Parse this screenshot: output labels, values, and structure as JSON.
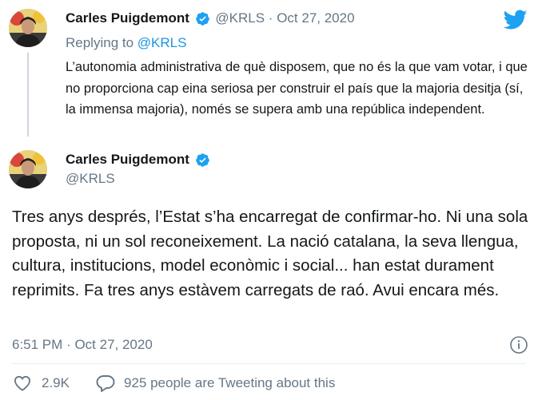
{
  "reply_tweet": {
    "author_name": "Carles Puigdemont",
    "handle": "@KRLS",
    "separator": "·",
    "date": "Oct 27, 2020",
    "replying_label": "Replying to",
    "replying_handle": "@KRLS",
    "text": "L’autonomia administrativa de què disposem, que no és la que vam votar, i que no proporciona cap eina seriosa per construir el país que la majoria desitja (sí, la immensa majoria), només se supera amb una república independent."
  },
  "main_tweet": {
    "author_name": "Carles Puigdemont",
    "handle": "@KRLS",
    "text": "Tres anys després, l’Estat s’ha encarregat de confirmar-ho. Ni una sola proposta, ni un sol reconeixement. La nació catalana, la seva llengua, cultura, institucions, model econòmic i social... han estat durament reprimits. Fa tres anys estàvem carregats de raó. Avui encara més.",
    "time": "6:51 PM",
    "separator": "·",
    "date": "Oct 27, 2020"
  },
  "actions": {
    "likes": "2.9K",
    "tweeting_text": "925 people are Tweeting about this"
  },
  "icons": {
    "brand": "twitter-bird-icon",
    "verified": "verified-badge-icon",
    "info": "info-icon",
    "like": "heart-icon",
    "comment": "speech-bubble-icon"
  },
  "colors": {
    "twitter_blue": "#1da1f2",
    "link_blue": "#1b95e0",
    "muted_gray": "#657786",
    "text_dark": "#14171a"
  }
}
